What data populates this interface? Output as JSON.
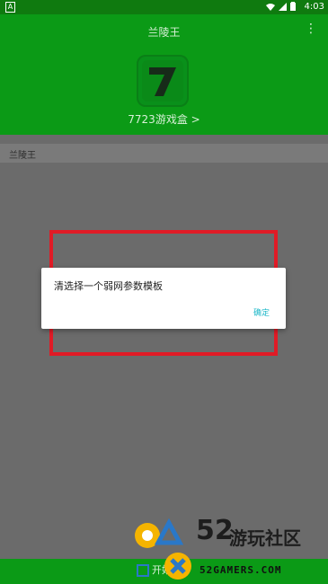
{
  "status_bar": {
    "time": "4:03"
  },
  "header": {
    "title": "兰陵王",
    "more_icon": "more-vert-icon",
    "app_icon_label": "7",
    "box_link": "7723游戏盒 >"
  },
  "list": {
    "items": [
      {
        "label": "兰陵王"
      }
    ]
  },
  "dialog": {
    "message": "清选择一个弱网参数模板",
    "ok_label": "确定"
  },
  "bottom_bar": {
    "button_label": "开始"
  },
  "watermark": {
    "number": "52",
    "text_cn": "游玩社区",
    "text_en": "52GAMERS.COM"
  },
  "colors": {
    "header_green": "#0b9a16",
    "status_green": "#0f7a0f",
    "overlay_gray": "#6b6b6b",
    "accent_cyan": "#1bb7c8",
    "highlight_red": "#e01b26",
    "logo_yellow": "#f5b400",
    "logo_blue": "#2a78c8"
  }
}
